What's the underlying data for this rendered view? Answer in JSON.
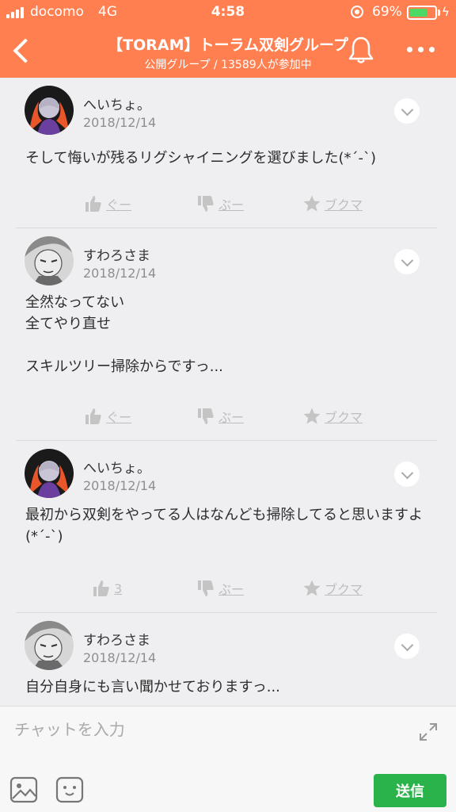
{
  "status": {
    "carrier": "docomo",
    "network": "4G",
    "time": "4:58",
    "battery_pct": "69%",
    "battery_level": 0.69
  },
  "header": {
    "title": "【TORAM】トーラム双剣グループ",
    "subtitle": "公開グループ / 13589人が参加中"
  },
  "labels": {
    "good": "ぐー",
    "bad": "ぶー",
    "bookmark": "ブクマ"
  },
  "posts": [
    {
      "user": "へいちょ。",
      "date": "2018/12/14",
      "body": "そして悔いが残るリグシャイニングを選びました(*´-`)",
      "good": "ぐー",
      "bad": "ぶー",
      "bookmark": "ブクマ"
    },
    {
      "user": "すわろさま",
      "date": "2018/12/14",
      "body": "全然なってない\n全てやり直せ\n\nスキルツリー掃除からですっ...",
      "good": "ぐー",
      "bad": "ぶー",
      "bookmark": "ブクマ"
    },
    {
      "user": "へいちょ。",
      "date": "2018/12/14",
      "body": "最初から双剣をやってる人はなんども掃除してると思いますよ(*´-`)",
      "good": "3",
      "bad": "ぶー",
      "bookmark": "ブクマ"
    },
    {
      "user": "すわろさま",
      "date": "2018/12/14",
      "body": "自分自身にも言い聞かせておりますっ..."
    }
  ],
  "composer": {
    "placeholder": "チャットを入力",
    "send_label": "送信"
  },
  "colors": {
    "header": "#ff7f50",
    "send": "#2ab24b",
    "action_gray": "#bdbdbd"
  },
  "icons": [
    "signal-icon",
    "location-lock-icon",
    "battery-icon",
    "back-icon",
    "bell-icon",
    "more-icon",
    "thumbs-up-icon",
    "thumbs-down-icon",
    "star-icon",
    "chevron-down-icon",
    "expand-icon",
    "image-icon",
    "emoji-icon"
  ]
}
